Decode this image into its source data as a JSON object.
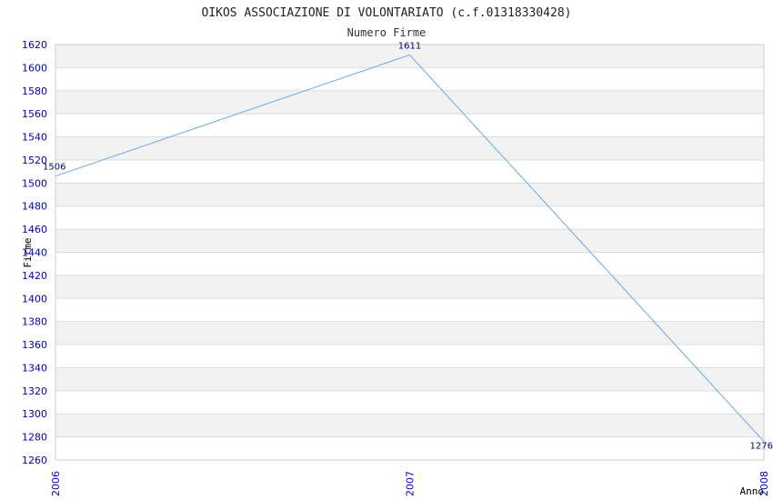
{
  "chart_data": {
    "type": "line",
    "title": "OIKOS ASSOCIAZIONE DI VOLONTARIATO (c.f.01318330428)",
    "subtitle": "Numero Firme",
    "xlabel": "Anno",
    "ylabel": "Firme",
    "x": [
      "2006",
      "2007",
      "2008"
    ],
    "series": [
      {
        "values": [
          1506,
          1611,
          1276
        ],
        "data_labels": [
          "1506",
          "1611",
          "1276"
        ]
      }
    ],
    "ylim": [
      1260,
      1620
    ],
    "yticks": [
      "1260",
      "1280",
      "1300",
      "1320",
      "1340",
      "1360",
      "1380",
      "1400",
      "1420",
      "1440",
      "1460",
      "1480",
      "1500",
      "1520",
      "1540",
      "1560",
      "1580",
      "1600",
      "1620"
    ],
    "grid": true,
    "banded_background": true,
    "colors": {
      "line": "#66aaee",
      "band": "#f2f2f2",
      "grid": "#dddddd",
      "tick_text": "#0000cc",
      "data_label": "#000088"
    }
  }
}
